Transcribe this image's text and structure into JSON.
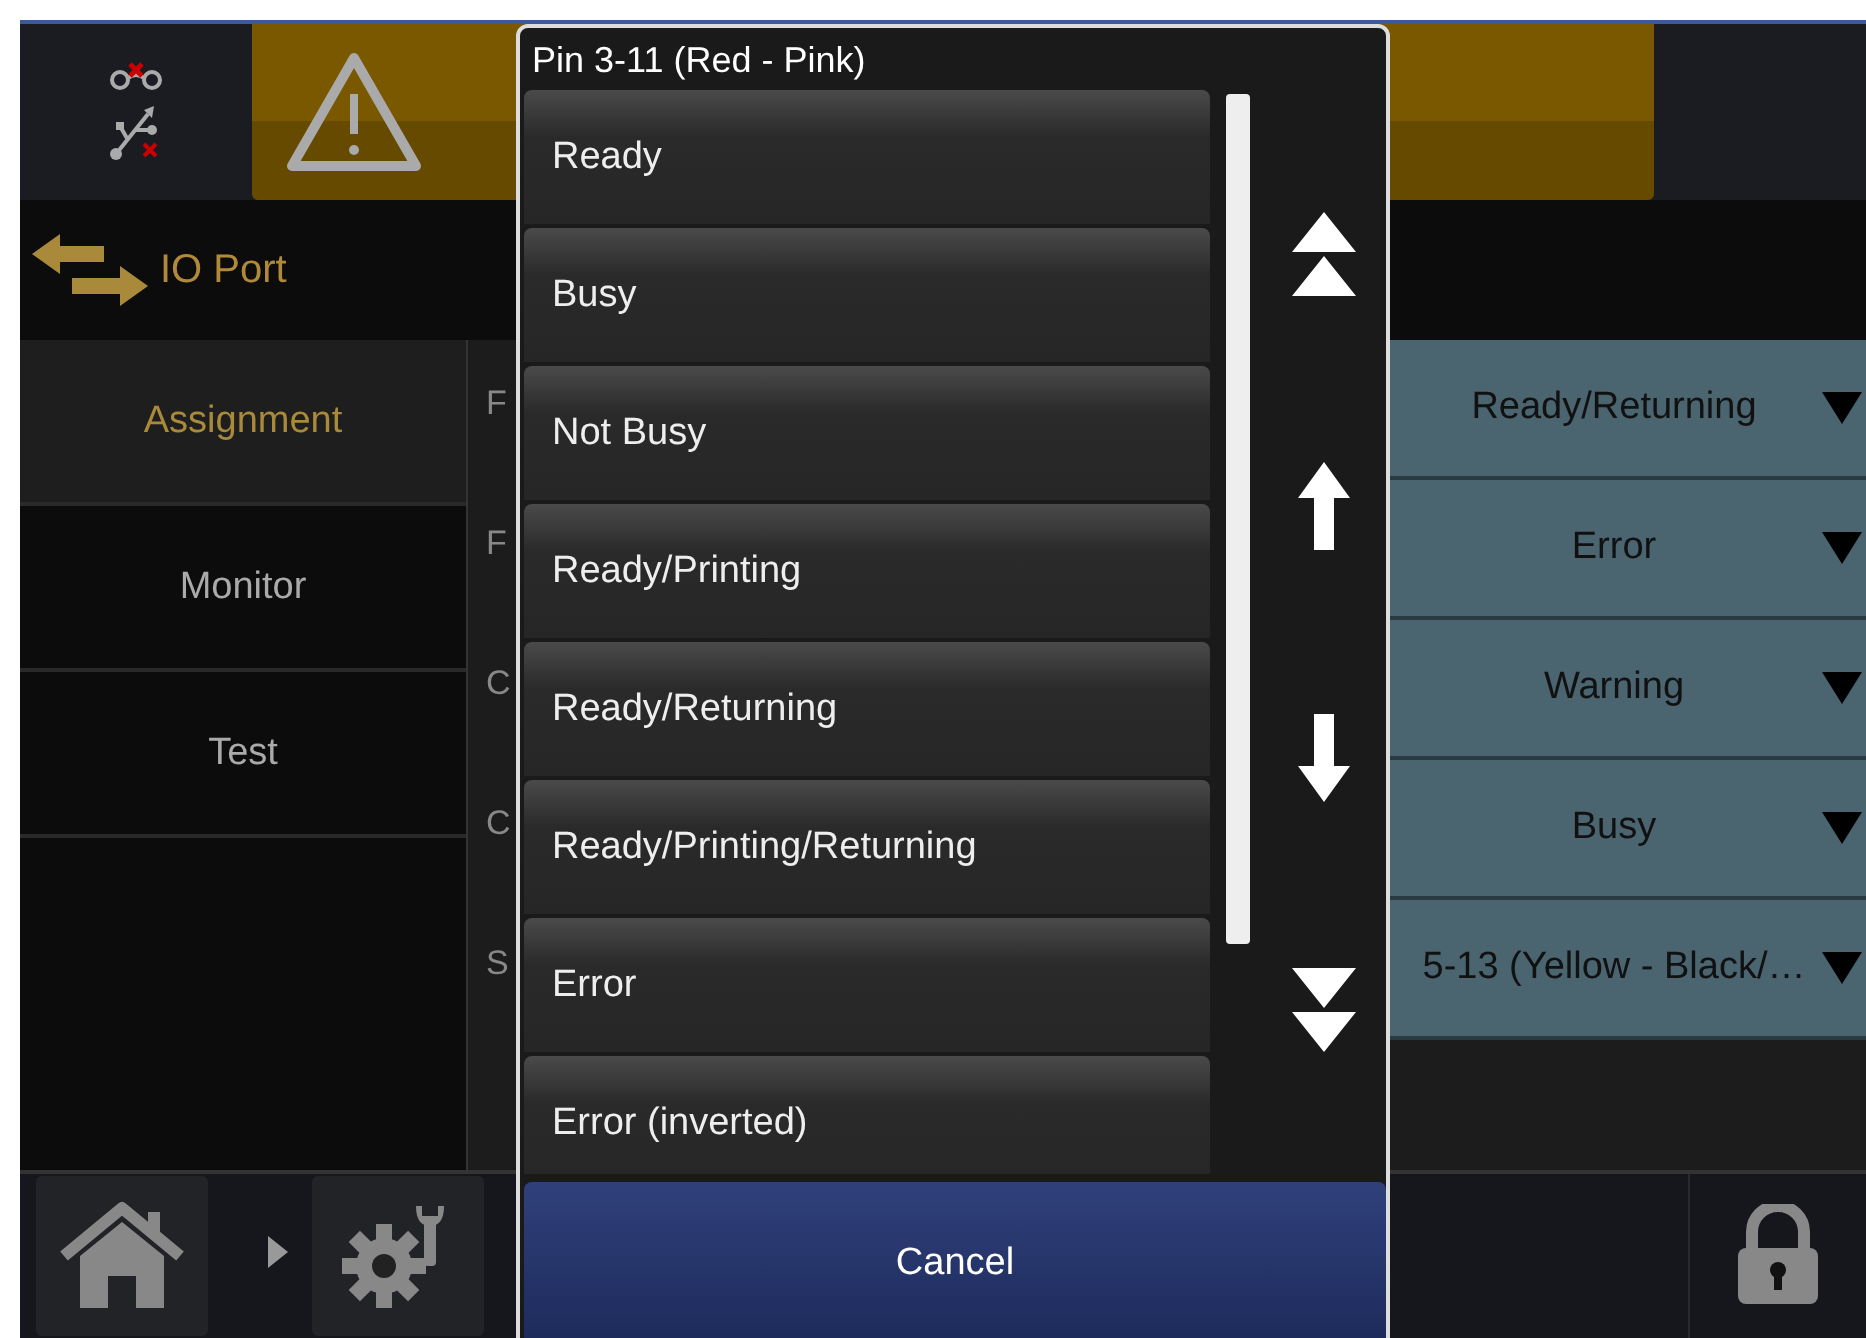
{
  "page_title": "IO Port",
  "sidebar": [
    {
      "label": "Assignment",
      "selected": true
    },
    {
      "label": "Monitor",
      "selected": false
    },
    {
      "label": "Test",
      "selected": false
    }
  ],
  "rows": [
    {
      "label": "F",
      "value": "Ready/Returning"
    },
    {
      "label": "F",
      "value": "Error"
    },
    {
      "label": "C",
      "value": "Warning"
    },
    {
      "label": "C",
      "value": "Busy"
    },
    {
      "label": "S",
      "value": "5-13 (Yellow - Black/…"
    }
  ],
  "dialog": {
    "title": "Pin 3-11 (Red - Pink)",
    "options": [
      "Ready",
      "Busy",
      "Not Busy",
      "Ready/Printing",
      "Ready/Returning",
      "Ready/Printing/Returning",
      "Error",
      "Error (inverted)"
    ],
    "cancel": "Cancel"
  }
}
